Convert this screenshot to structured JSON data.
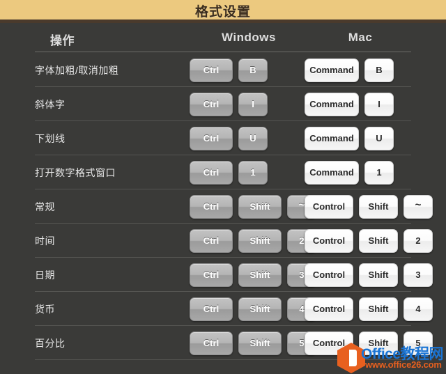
{
  "header": {
    "title": "格式设置",
    "bar_color": "#ecc97f",
    "title_color": "#3b2d1e",
    "rule_color": "#4a3a2c"
  },
  "table": {
    "columns": {
      "action": "操作",
      "windows": "Windows",
      "mac": "Mac"
    },
    "rows": [
      {
        "action": "字体加粗/取消加粗",
        "windows": [
          "Ctrl",
          "B"
        ],
        "mac": [
          "Command",
          "B"
        ]
      },
      {
        "action": "斜体字",
        "windows": [
          "Ctrl",
          "I"
        ],
        "mac": [
          "Command",
          "I"
        ]
      },
      {
        "action": "下划线",
        "windows": [
          "Ctrl",
          "U"
        ],
        "mac": [
          "Command",
          "U"
        ]
      },
      {
        "action": "打开数字格式窗口",
        "windows": [
          "Ctrl",
          "1"
        ],
        "mac": [
          "Command",
          "1"
        ]
      },
      {
        "action": "常规",
        "windows": [
          "Ctrl",
          "Shift",
          "~"
        ],
        "mac": [
          "Control",
          "Shift",
          "~"
        ]
      },
      {
        "action": "时间",
        "windows": [
          "Ctrl",
          "Shift",
          "2"
        ],
        "mac": [
          "Control",
          "Shift",
          "2"
        ]
      },
      {
        "action": "日期",
        "windows": [
          "Ctrl",
          "Shift",
          "3"
        ],
        "mac": [
          "Control",
          "Shift",
          "3"
        ]
      },
      {
        "action": "货币",
        "windows": [
          "Ctrl",
          "Shift",
          "4"
        ],
        "mac": [
          "Control",
          "Shift",
          "4"
        ]
      },
      {
        "action": "百分比",
        "windows": [
          "Ctrl",
          "Shift",
          "5"
        ],
        "mac": [
          "Control",
          "Shift",
          "5"
        ]
      }
    ]
  },
  "watermark": {
    "brand_office": "Office",
    "brand_cn": "教程网",
    "url": "www.office26.com",
    "logo_color": "#e8601f",
    "text_color": "#1a74d4"
  },
  "theme": {
    "background": "#3a3a38",
    "row_separator": "#565653",
    "header_separator": "#6d6d6a",
    "text": "#e8e8e8"
  }
}
